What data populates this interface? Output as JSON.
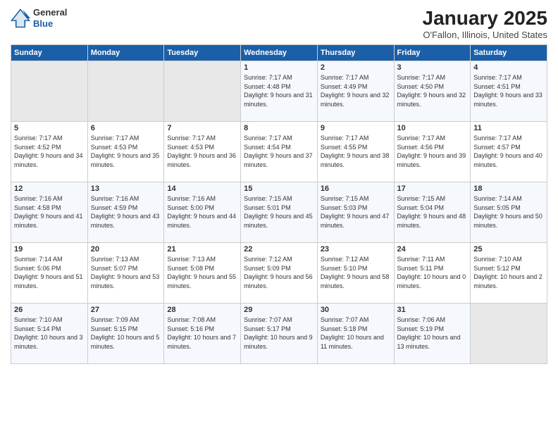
{
  "logo": {
    "general": "General",
    "blue": "Blue"
  },
  "title": "January 2025",
  "subtitle": "O'Fallon, Illinois, United States",
  "headers": [
    "Sunday",
    "Monday",
    "Tuesday",
    "Wednesday",
    "Thursday",
    "Friday",
    "Saturday"
  ],
  "weeks": [
    [
      {
        "day": "",
        "empty": true
      },
      {
        "day": "",
        "empty": true
      },
      {
        "day": "",
        "empty": true
      },
      {
        "day": "1",
        "sunrise": "7:17 AM",
        "sunset": "4:48 PM",
        "daylight": "9 hours and 31 minutes."
      },
      {
        "day": "2",
        "sunrise": "7:17 AM",
        "sunset": "4:49 PM",
        "daylight": "9 hours and 32 minutes."
      },
      {
        "day": "3",
        "sunrise": "7:17 AM",
        "sunset": "4:50 PM",
        "daylight": "9 hours and 32 minutes."
      },
      {
        "day": "4",
        "sunrise": "7:17 AM",
        "sunset": "4:51 PM",
        "daylight": "9 hours and 33 minutes."
      }
    ],
    [
      {
        "day": "5",
        "sunrise": "7:17 AM",
        "sunset": "4:52 PM",
        "daylight": "9 hours and 34 minutes."
      },
      {
        "day": "6",
        "sunrise": "7:17 AM",
        "sunset": "4:53 PM",
        "daylight": "9 hours and 35 minutes."
      },
      {
        "day": "7",
        "sunrise": "7:17 AM",
        "sunset": "4:53 PM",
        "daylight": "9 hours and 36 minutes."
      },
      {
        "day": "8",
        "sunrise": "7:17 AM",
        "sunset": "4:54 PM",
        "daylight": "9 hours and 37 minutes."
      },
      {
        "day": "9",
        "sunrise": "7:17 AM",
        "sunset": "4:55 PM",
        "daylight": "9 hours and 38 minutes."
      },
      {
        "day": "10",
        "sunrise": "7:17 AM",
        "sunset": "4:56 PM",
        "daylight": "9 hours and 39 minutes."
      },
      {
        "day": "11",
        "sunrise": "7:17 AM",
        "sunset": "4:57 PM",
        "daylight": "9 hours and 40 minutes."
      }
    ],
    [
      {
        "day": "12",
        "sunrise": "7:16 AM",
        "sunset": "4:58 PM",
        "daylight": "9 hours and 41 minutes."
      },
      {
        "day": "13",
        "sunrise": "7:16 AM",
        "sunset": "4:59 PM",
        "daylight": "9 hours and 43 minutes."
      },
      {
        "day": "14",
        "sunrise": "7:16 AM",
        "sunset": "5:00 PM",
        "daylight": "9 hours and 44 minutes."
      },
      {
        "day": "15",
        "sunrise": "7:15 AM",
        "sunset": "5:01 PM",
        "daylight": "9 hours and 45 minutes."
      },
      {
        "day": "16",
        "sunrise": "7:15 AM",
        "sunset": "5:03 PM",
        "daylight": "9 hours and 47 minutes."
      },
      {
        "day": "17",
        "sunrise": "7:15 AM",
        "sunset": "5:04 PM",
        "daylight": "9 hours and 48 minutes."
      },
      {
        "day": "18",
        "sunrise": "7:14 AM",
        "sunset": "5:05 PM",
        "daylight": "9 hours and 50 minutes."
      }
    ],
    [
      {
        "day": "19",
        "sunrise": "7:14 AM",
        "sunset": "5:06 PM",
        "daylight": "9 hours and 51 minutes."
      },
      {
        "day": "20",
        "sunrise": "7:13 AM",
        "sunset": "5:07 PM",
        "daylight": "9 hours and 53 minutes."
      },
      {
        "day": "21",
        "sunrise": "7:13 AM",
        "sunset": "5:08 PM",
        "daylight": "9 hours and 55 minutes."
      },
      {
        "day": "22",
        "sunrise": "7:12 AM",
        "sunset": "5:09 PM",
        "daylight": "9 hours and 56 minutes."
      },
      {
        "day": "23",
        "sunrise": "7:12 AM",
        "sunset": "5:10 PM",
        "daylight": "9 hours and 58 minutes."
      },
      {
        "day": "24",
        "sunrise": "7:11 AM",
        "sunset": "5:11 PM",
        "daylight": "10 hours and 0 minutes."
      },
      {
        "day": "25",
        "sunrise": "7:10 AM",
        "sunset": "5:12 PM",
        "daylight": "10 hours and 2 minutes."
      }
    ],
    [
      {
        "day": "26",
        "sunrise": "7:10 AM",
        "sunset": "5:14 PM",
        "daylight": "10 hours and 3 minutes."
      },
      {
        "day": "27",
        "sunrise": "7:09 AM",
        "sunset": "5:15 PM",
        "daylight": "10 hours and 5 minutes."
      },
      {
        "day": "28",
        "sunrise": "7:08 AM",
        "sunset": "5:16 PM",
        "daylight": "10 hours and 7 minutes."
      },
      {
        "day": "29",
        "sunrise": "7:07 AM",
        "sunset": "5:17 PM",
        "daylight": "10 hours and 9 minutes."
      },
      {
        "day": "30",
        "sunrise": "7:07 AM",
        "sunset": "5:18 PM",
        "daylight": "10 hours and 11 minutes."
      },
      {
        "day": "31",
        "sunrise": "7:06 AM",
        "sunset": "5:19 PM",
        "daylight": "10 hours and 13 minutes."
      },
      {
        "day": "",
        "empty": true
      }
    ]
  ]
}
